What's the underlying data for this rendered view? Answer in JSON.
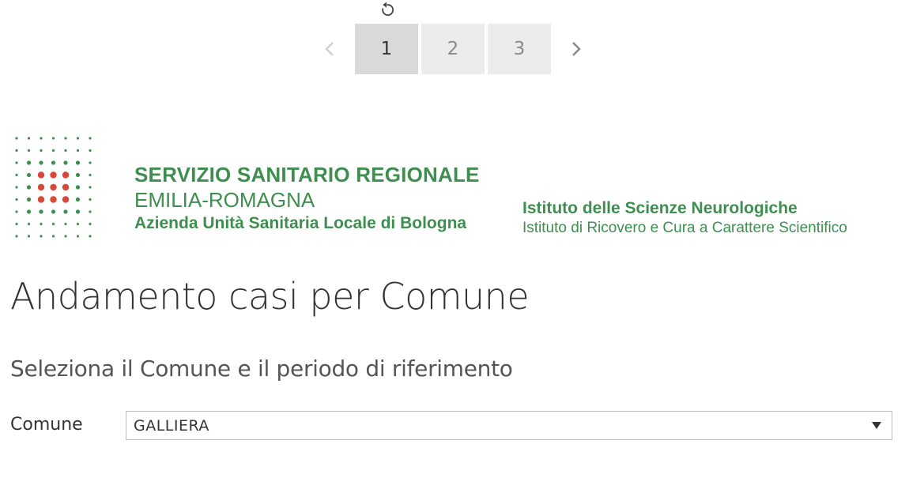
{
  "toolbar": {
    "refresh_icon": "refresh-icon",
    "prev_icon": "chevron-left-icon",
    "next_icon": "chevron-right-icon",
    "pages": [
      {
        "label": "1",
        "active": true
      },
      {
        "label": "2",
        "active": false
      },
      {
        "label": "3",
        "active": false
      }
    ]
  },
  "header": {
    "org": {
      "line1": "SERVIZIO SANITARIO REGIONALE",
      "line2": "EMILIA-ROMAGNA",
      "line3": "Azienda Unità Sanitaria Locale di Bologna"
    },
    "institute": {
      "line1": "Istituto delle Scienze Neurologiche",
      "line2": "Istituto di Ricovero e Cura a Carattere Scientifico"
    },
    "brand_colors": {
      "green": "#3e8e4f",
      "red": "#d64a3b"
    }
  },
  "main": {
    "title": "Andamento casi per Comune",
    "subtitle": "Seleziona il Comune e il periodo di riferimento",
    "comune_label": "Comune",
    "comune_value": "GALLIERA"
  }
}
